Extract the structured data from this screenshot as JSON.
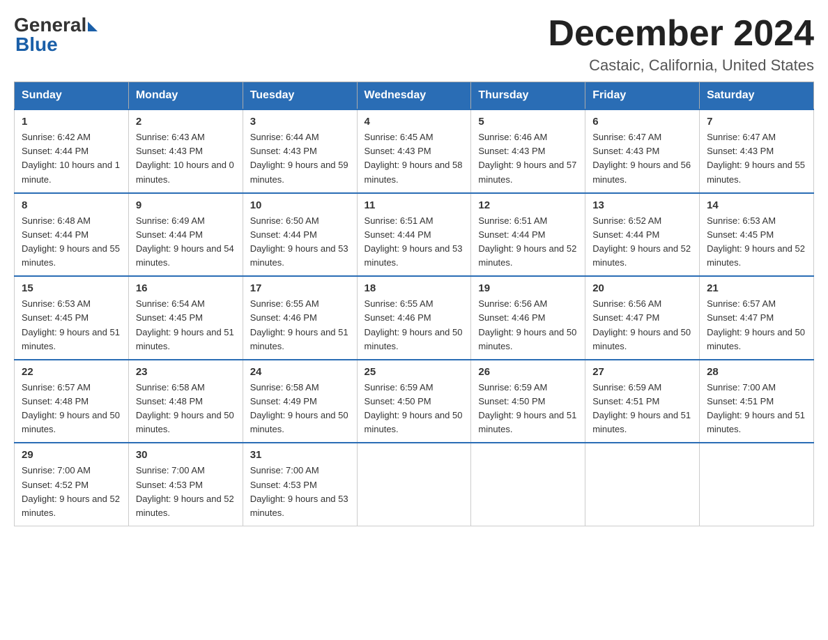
{
  "logo": {
    "general": "General",
    "blue": "Blue"
  },
  "header": {
    "month": "December 2024",
    "location": "Castaic, California, United States"
  },
  "weekdays": [
    "Sunday",
    "Monday",
    "Tuesday",
    "Wednesday",
    "Thursday",
    "Friday",
    "Saturday"
  ],
  "weeks": [
    [
      {
        "day": "1",
        "sunrise": "6:42 AM",
        "sunset": "4:44 PM",
        "daylight": "10 hours and 1 minute."
      },
      {
        "day": "2",
        "sunrise": "6:43 AM",
        "sunset": "4:43 PM",
        "daylight": "10 hours and 0 minutes."
      },
      {
        "day": "3",
        "sunrise": "6:44 AM",
        "sunset": "4:43 PM",
        "daylight": "9 hours and 59 minutes."
      },
      {
        "day": "4",
        "sunrise": "6:45 AM",
        "sunset": "4:43 PM",
        "daylight": "9 hours and 58 minutes."
      },
      {
        "day": "5",
        "sunrise": "6:46 AM",
        "sunset": "4:43 PM",
        "daylight": "9 hours and 57 minutes."
      },
      {
        "day": "6",
        "sunrise": "6:47 AM",
        "sunset": "4:43 PM",
        "daylight": "9 hours and 56 minutes."
      },
      {
        "day": "7",
        "sunrise": "6:47 AM",
        "sunset": "4:43 PM",
        "daylight": "9 hours and 55 minutes."
      }
    ],
    [
      {
        "day": "8",
        "sunrise": "6:48 AM",
        "sunset": "4:44 PM",
        "daylight": "9 hours and 55 minutes."
      },
      {
        "day": "9",
        "sunrise": "6:49 AM",
        "sunset": "4:44 PM",
        "daylight": "9 hours and 54 minutes."
      },
      {
        "day": "10",
        "sunrise": "6:50 AM",
        "sunset": "4:44 PM",
        "daylight": "9 hours and 53 minutes."
      },
      {
        "day": "11",
        "sunrise": "6:51 AM",
        "sunset": "4:44 PM",
        "daylight": "9 hours and 53 minutes."
      },
      {
        "day": "12",
        "sunrise": "6:51 AM",
        "sunset": "4:44 PM",
        "daylight": "9 hours and 52 minutes."
      },
      {
        "day": "13",
        "sunrise": "6:52 AM",
        "sunset": "4:44 PM",
        "daylight": "9 hours and 52 minutes."
      },
      {
        "day": "14",
        "sunrise": "6:53 AM",
        "sunset": "4:45 PM",
        "daylight": "9 hours and 52 minutes."
      }
    ],
    [
      {
        "day": "15",
        "sunrise": "6:53 AM",
        "sunset": "4:45 PM",
        "daylight": "9 hours and 51 minutes."
      },
      {
        "day": "16",
        "sunrise": "6:54 AM",
        "sunset": "4:45 PM",
        "daylight": "9 hours and 51 minutes."
      },
      {
        "day": "17",
        "sunrise": "6:55 AM",
        "sunset": "4:46 PM",
        "daylight": "9 hours and 51 minutes."
      },
      {
        "day": "18",
        "sunrise": "6:55 AM",
        "sunset": "4:46 PM",
        "daylight": "9 hours and 50 minutes."
      },
      {
        "day": "19",
        "sunrise": "6:56 AM",
        "sunset": "4:46 PM",
        "daylight": "9 hours and 50 minutes."
      },
      {
        "day": "20",
        "sunrise": "6:56 AM",
        "sunset": "4:47 PM",
        "daylight": "9 hours and 50 minutes."
      },
      {
        "day": "21",
        "sunrise": "6:57 AM",
        "sunset": "4:47 PM",
        "daylight": "9 hours and 50 minutes."
      }
    ],
    [
      {
        "day": "22",
        "sunrise": "6:57 AM",
        "sunset": "4:48 PM",
        "daylight": "9 hours and 50 minutes."
      },
      {
        "day": "23",
        "sunrise": "6:58 AM",
        "sunset": "4:48 PM",
        "daylight": "9 hours and 50 minutes."
      },
      {
        "day": "24",
        "sunrise": "6:58 AM",
        "sunset": "4:49 PM",
        "daylight": "9 hours and 50 minutes."
      },
      {
        "day": "25",
        "sunrise": "6:59 AM",
        "sunset": "4:50 PM",
        "daylight": "9 hours and 50 minutes."
      },
      {
        "day": "26",
        "sunrise": "6:59 AM",
        "sunset": "4:50 PM",
        "daylight": "9 hours and 51 minutes."
      },
      {
        "day": "27",
        "sunrise": "6:59 AM",
        "sunset": "4:51 PM",
        "daylight": "9 hours and 51 minutes."
      },
      {
        "day": "28",
        "sunrise": "7:00 AM",
        "sunset": "4:51 PM",
        "daylight": "9 hours and 51 minutes."
      }
    ],
    [
      {
        "day": "29",
        "sunrise": "7:00 AM",
        "sunset": "4:52 PM",
        "daylight": "9 hours and 52 minutes."
      },
      {
        "day": "30",
        "sunrise": "7:00 AM",
        "sunset": "4:53 PM",
        "daylight": "9 hours and 52 minutes."
      },
      {
        "day": "31",
        "sunrise": "7:00 AM",
        "sunset": "4:53 PM",
        "daylight": "9 hours and 53 minutes."
      },
      null,
      null,
      null,
      null
    ]
  ]
}
